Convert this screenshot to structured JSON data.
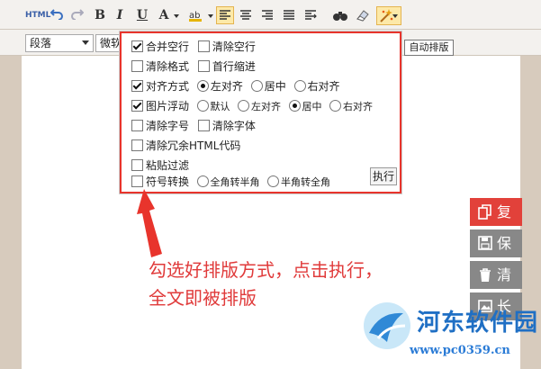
{
  "toolbar": {
    "html_label": "HTML",
    "bold": "B",
    "italic": "I",
    "underline": "U",
    "font_color": "A",
    "style_select": "段落",
    "font_select": "微软"
  },
  "panel": {
    "merge_blank": "合并空行",
    "clear_blank": "清除空行",
    "clear_format": "清除格式",
    "first_indent": "首行缩进",
    "align_mode": "对齐方式",
    "align_left": "左对齐",
    "align_center": "居中",
    "align_right": "右对齐",
    "image_float": "图片浮动",
    "float_default": "默认",
    "float_left": "左对齐",
    "float_center": "居中",
    "float_right": "右对齐",
    "clear_fontsize": "清除字号",
    "clear_fontface": "清除字体",
    "clear_html": "清除冗余HTML代码",
    "paste_filter": "粘贴过滤",
    "symbol_convert": "符号转换",
    "full_to_half": "全角转半角",
    "half_to_full": "半角转全角",
    "execute": "执行"
  },
  "tooltip": "自动排版",
  "side_buttons": {
    "copy": "复制",
    "save": "保存",
    "clear": "清空",
    "longimage": "长图"
  },
  "annotation": {
    "line1": "勾选好排版方式，点击执行，",
    "line2": "全文即被排版"
  },
  "watermark": {
    "name": "河东软件园",
    "url": "www.pc0359.cn"
  },
  "colors": {
    "accent_red": "#e8342c",
    "annotation_red": "#e03a3a",
    "watermark_blue": "#1f6fc4"
  }
}
